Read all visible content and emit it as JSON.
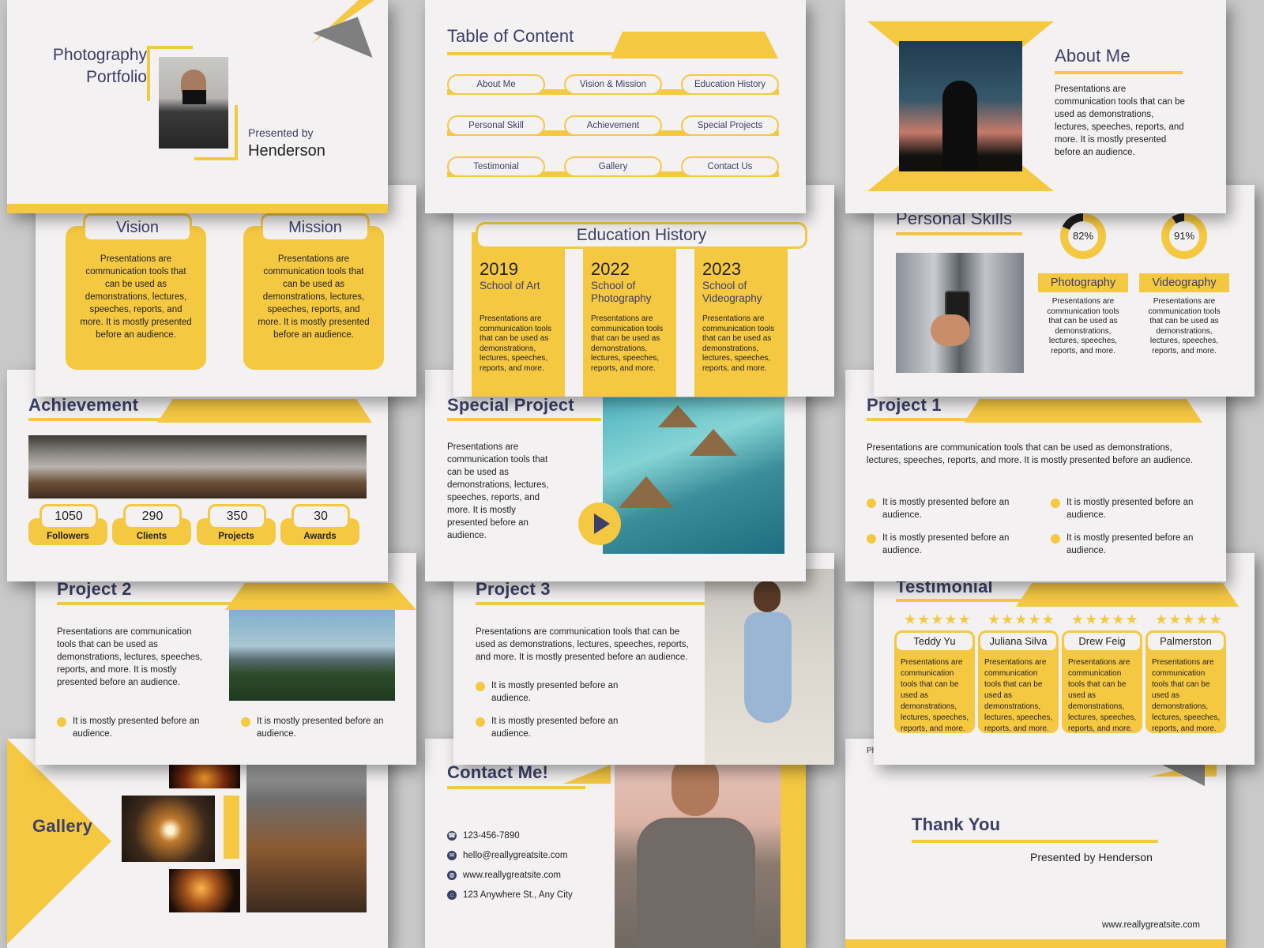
{
  "cover": {
    "title_line1": "Photography",
    "title_line2": "Portfolio",
    "presented_by": "Presented by",
    "name": "Henderson"
  },
  "toc": {
    "title": "Table of Content",
    "items": [
      "About Me",
      "Vision & Mission",
      "Education History",
      "Personal Skill",
      "Achievement",
      "Special Projects",
      "Testimonial",
      "Gallery",
      "Contact Us"
    ]
  },
  "about": {
    "title": "About Me",
    "text": "Presentations are communication tools that can be used as demonstrations, lectures, speeches, reports, and more. It is mostly presented before an audience."
  },
  "vision": {
    "title": "Vision",
    "text": "Presentations are communication tools that can be used as demonstrations, lectures, speeches, reports, and more. It is mostly presented before an audience."
  },
  "mission": {
    "title": "Mission",
    "text": "Presentations are communication tools that can be used as demonstrations, lectures, speeches, reports, and more. It is mostly presented before an audience."
  },
  "education": {
    "title": "Education History",
    "items": [
      {
        "year": "2019",
        "school": "School of Art",
        "text": "Presentations are communication tools that can be used as demonstrations, lectures, speeches, reports, and more."
      },
      {
        "year": "2022",
        "school": "School of Photography",
        "text": "Presentations are communication tools that can be used as demonstrations, lectures, speeches, reports, and more."
      },
      {
        "year": "2023",
        "school": "School of Videography",
        "text": "Presentations are communication tools that can be used as demonstrations, lectures, speeches, reports, and more."
      }
    ]
  },
  "skills": {
    "title": "Personal Skills",
    "items": [
      {
        "percent_label": "82%",
        "percent": 82,
        "name": "Photography",
        "text": "Presentations are communication tools that can be used as demonstrations, lectures, speeches, reports, and more."
      },
      {
        "percent_label": "91%",
        "percent": 91,
        "name": "Videography",
        "text": "Presentations are communication tools that can be used as demonstrations, lectures, speeches, reports, and more."
      }
    ]
  },
  "achievement": {
    "title": "Achievement",
    "stats": [
      {
        "value": "1050",
        "label": "Followers"
      },
      {
        "value": "290",
        "label": "Clients"
      },
      {
        "value": "350",
        "label": "Projects"
      },
      {
        "value": "30",
        "label": "Awards"
      }
    ]
  },
  "special": {
    "title": "Special Project",
    "text": "Presentations are communication tools that can be used as demonstrations, lectures, speeches, reports, and more. It is mostly presented before an audience."
  },
  "project1": {
    "title": "Project 1",
    "text": "Presentations are communication tools that can be used as demonstrations, lectures, speeches, reports, and more. It is mostly presented before an audience.",
    "bullets": [
      "It is mostly presented before an audience.",
      "It is mostly presented before an audience.",
      "It is mostly presented before an audience.",
      "It is mostly presented before an audience."
    ]
  },
  "project2": {
    "title": "Project 2",
    "text": "Presentations are communication tools that can be used as demonstrations, lectures, speeches, reports, and more. It is mostly presented before an audience.",
    "bullets": [
      "It is mostly presented before an audience.",
      "It is mostly presented before an audience."
    ]
  },
  "project3": {
    "title": "Project 3",
    "text": "Presentations are communication tools that can be used as demonstrations, lectures, speeches, reports, and more. It is mostly presented before an audience.",
    "bullets": [
      "It is mostly presented before an audience.",
      "It is mostly presented before an audience."
    ]
  },
  "testimonial": {
    "title": "Testimonial",
    "stars": "★★★★★",
    "items": [
      {
        "name": "Teddy Yu",
        "text": "Presentations are communication tools that can be used as demonstrations, lectures, speeches, reports, and more."
      },
      {
        "name": "Juliana Silva",
        "text": "Presentations are communication tools that can be used as demonstrations, lectures, speeches, reports, and more."
      },
      {
        "name": "Drew Feig",
        "text": "Presentations are communication tools that can be used as demonstrations, lectures, speeches, reports, and more."
      },
      {
        "name": "Palmerston",
        "text": "Presentations are communication tools that can be used as demonstrations, lectures, speeches, reports, and more."
      }
    ]
  },
  "gallery": {
    "title": "Gallery"
  },
  "contact": {
    "title": "Contact Me!",
    "phone": "123-456-7890",
    "email": "hello@reallygreatsite.com",
    "website": "www.reallygreatsite.com",
    "address": "123 Anywhere St., Any City"
  },
  "thanks": {
    "title": "Thank You",
    "presented_by": "Presented by Henderson",
    "website": "www.reallygreatsite.com",
    "corner_text": "Ph"
  },
  "colors": {
    "accent": "#f5c842",
    "navy": "#3c3f67",
    "slide_bg": "#f3f1f1",
    "backdrop": "#c9c9c9"
  }
}
